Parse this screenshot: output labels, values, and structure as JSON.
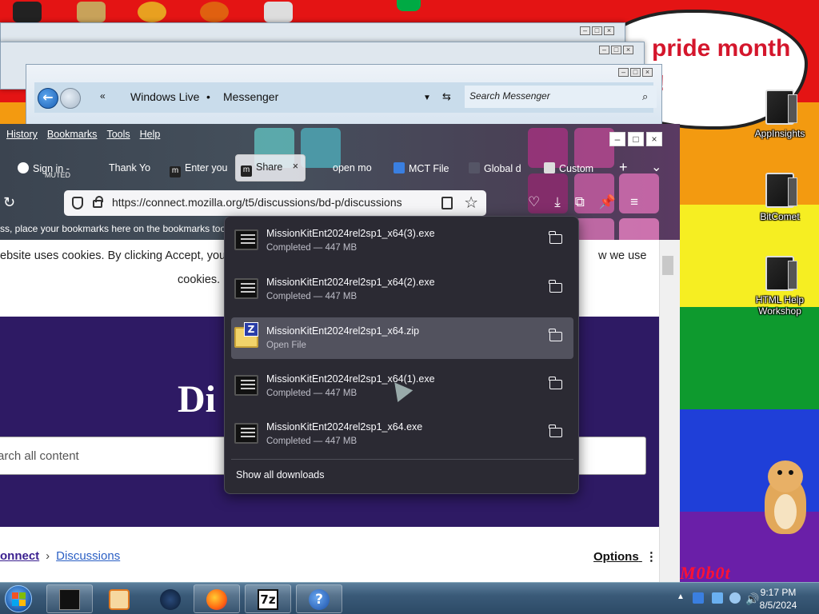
{
  "desktop": {
    "banner_text": "pride month",
    "banner_excl": "!",
    "icons": [
      {
        "label": "AppInsights",
        "icon": "appinsights-icon"
      },
      {
        "label": "BitComet",
        "icon": "bitcomet-icon"
      },
      {
        "label": "HTML Help Workshop",
        "icon": "html-help-workshop-icon"
      }
    ],
    "hamster_sign": "M0b0t"
  },
  "messenger": {
    "breadcrumb_root": "Windows Live",
    "breadcrumb_child": "Messenger",
    "search_placeholder": "Search Messenger",
    "controls": [
      "–",
      "□",
      "×"
    ]
  },
  "firefox": {
    "menu": [
      "History",
      "Bookmarks",
      "Tools",
      "Help"
    ],
    "tabs": [
      {
        "label": "Sign in -",
        "sub": "MUTED",
        "icon": "google-icon"
      },
      {
        "label": "Thank Yo",
        "icon": "page-icon"
      },
      {
        "label": "Enter you",
        "icon": "m-icon"
      },
      {
        "label": "Share",
        "icon": "m-icon",
        "active": true
      },
      {
        "label": "open mo",
        "icon": "page-icon"
      },
      {
        "label": "MCT File",
        "icon": "doc-icon"
      },
      {
        "label": "Global d",
        "icon": "global-icon"
      },
      {
        "label": "Custom",
        "icon": "custom-icon"
      }
    ],
    "new_tab": "+",
    "tab_list": "⌄",
    "url": "https://connect.mozilla.org/t5/discussions/bd-p/discussions",
    "bookmarks_hint": "ss, place your bookmarks here on the bookmarks too",
    "window_controls": [
      "–",
      "□",
      "×"
    ]
  },
  "page": {
    "cookie_line1": "ebsite uses cookies. By clicking Accept, you",
    "cookie_line1_right": "w we use",
    "cookie_line2": "cookies.",
    "hero_title": "Di",
    "search_placeholder": "arch all content",
    "breadcrumb_root": "onnect",
    "breadcrumb_sep": "›",
    "breadcrumb_current": "Discussions",
    "options_label": "Options",
    "options_icon": "⋮"
  },
  "downloads": {
    "items": [
      {
        "name": "MissionKitEnt2024rel2sp1_x64(3).exe",
        "status": "Completed — 447 MB",
        "type": "exe"
      },
      {
        "name": "MissionKitEnt2024rel2sp1_x64(2).exe",
        "status": "Completed — 447 MB",
        "type": "exe"
      },
      {
        "name": "MissionKitEnt2024rel2sp1_x64.zip",
        "status": "Open File",
        "type": "zip"
      },
      {
        "name": "MissionKitEnt2024rel2sp1_x64(1).exe",
        "status": "Completed — 447 MB",
        "type": "exe"
      },
      {
        "name": "MissionKitEnt2024rel2sp1_x64.exe",
        "status": "Completed — 447 MB",
        "type": "exe"
      }
    ],
    "show_all": "Show all downloads"
  },
  "taskbar": {
    "apps": [
      "terminal-icon",
      "media-player-icon",
      "globe-icon",
      "firefox-icon",
      "7zip-icon",
      "help-icon"
    ],
    "sevenzip_label": "7z",
    "help_label": "?",
    "time": "9:17 PM",
    "date": "8/5/2024"
  },
  "colors": {
    "downloads_bg": "#2b2a33",
    "hero_bg": "#2e1a64",
    "link_blue": "#2a5fc4"
  }
}
